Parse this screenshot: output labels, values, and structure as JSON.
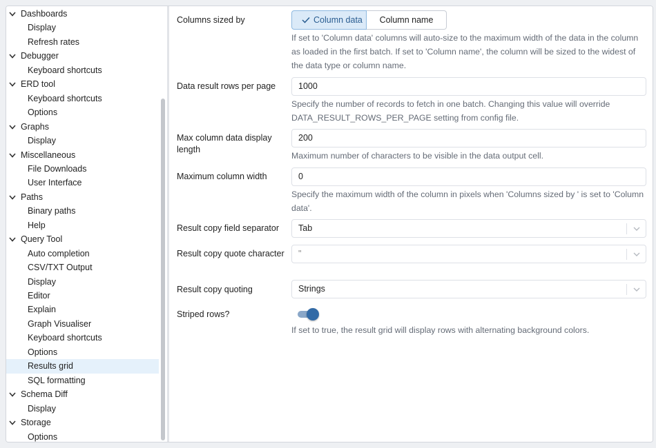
{
  "sidebar": {
    "rows": [
      {
        "label": "Dashboards",
        "type": "group"
      },
      {
        "label": "Display",
        "type": "child"
      },
      {
        "label": "Refresh rates",
        "type": "child"
      },
      {
        "label": "Debugger",
        "type": "group"
      },
      {
        "label": "Keyboard shortcuts",
        "type": "child"
      },
      {
        "label": "ERD tool",
        "type": "group"
      },
      {
        "label": "Keyboard shortcuts",
        "type": "child"
      },
      {
        "label": "Options",
        "type": "child"
      },
      {
        "label": "Graphs",
        "type": "group"
      },
      {
        "label": "Display",
        "type": "child"
      },
      {
        "label": "Miscellaneous",
        "type": "group"
      },
      {
        "label": "File Downloads",
        "type": "child"
      },
      {
        "label": "User Interface",
        "type": "child"
      },
      {
        "label": "Paths",
        "type": "group"
      },
      {
        "label": "Binary paths",
        "type": "child"
      },
      {
        "label": "Help",
        "type": "child"
      },
      {
        "label": "Query Tool",
        "type": "group"
      },
      {
        "label": "Auto completion",
        "type": "child"
      },
      {
        "label": "CSV/TXT Output",
        "type": "child"
      },
      {
        "label": "Display",
        "type": "child"
      },
      {
        "label": "Editor",
        "type": "child"
      },
      {
        "label": "Explain",
        "type": "child"
      },
      {
        "label": "Graph Visualiser",
        "type": "child"
      },
      {
        "label": "Keyboard shortcuts",
        "type": "child"
      },
      {
        "label": "Options",
        "type": "child"
      },
      {
        "label": "Results grid",
        "type": "child",
        "selected": true
      },
      {
        "label": "SQL formatting",
        "type": "child"
      },
      {
        "label": "Schema Diff",
        "type": "group"
      },
      {
        "label": "Display",
        "type": "child"
      },
      {
        "label": "Storage",
        "type": "group"
      },
      {
        "label": "Options",
        "type": "child"
      }
    ]
  },
  "settings": {
    "columns_sized_by": {
      "label": "Columns sized by",
      "options": [
        "Column data",
        "Column name"
      ],
      "selected": "Column data",
      "help": "If set to 'Column data' columns will auto-size to the maximum width of the data in the column as loaded in the first batch. If set to 'Column name', the column will be sized to the widest of the data type or column name."
    },
    "rows_per_page": {
      "label": "Data result rows per page",
      "value": "1000",
      "help": "Specify the number of records to fetch in one batch. Changing this value will override DATA_RESULT_ROWS_PER_PAGE setting from config file."
    },
    "max_display_length": {
      "label": "Max column data display length",
      "value": "200",
      "help": "Maximum number of characters to be visible in the data output cell."
    },
    "max_column_width": {
      "label": "Maximum column width",
      "value": "0",
      "help": "Specify the maximum width of the column in pixels when 'Columns sized by ' is set to 'Column data'."
    },
    "copy_field_separator": {
      "label": "Result copy field separator",
      "value": "Tab"
    },
    "copy_quote_character": {
      "label": "Result copy quote character",
      "value": "\""
    },
    "copy_quoting": {
      "label": "Result copy quoting",
      "value": "Strings"
    },
    "striped_rows": {
      "label": "Striped rows?",
      "enabled": true,
      "help": "If set to true, the result grid will display rows with alternating background colors."
    }
  },
  "colors": {
    "selected_row_bg": "#e5f1fb",
    "toggle_active_bg": "#dbeaf8",
    "switch_knob": "#326aa6",
    "help_text": "#646b76"
  }
}
